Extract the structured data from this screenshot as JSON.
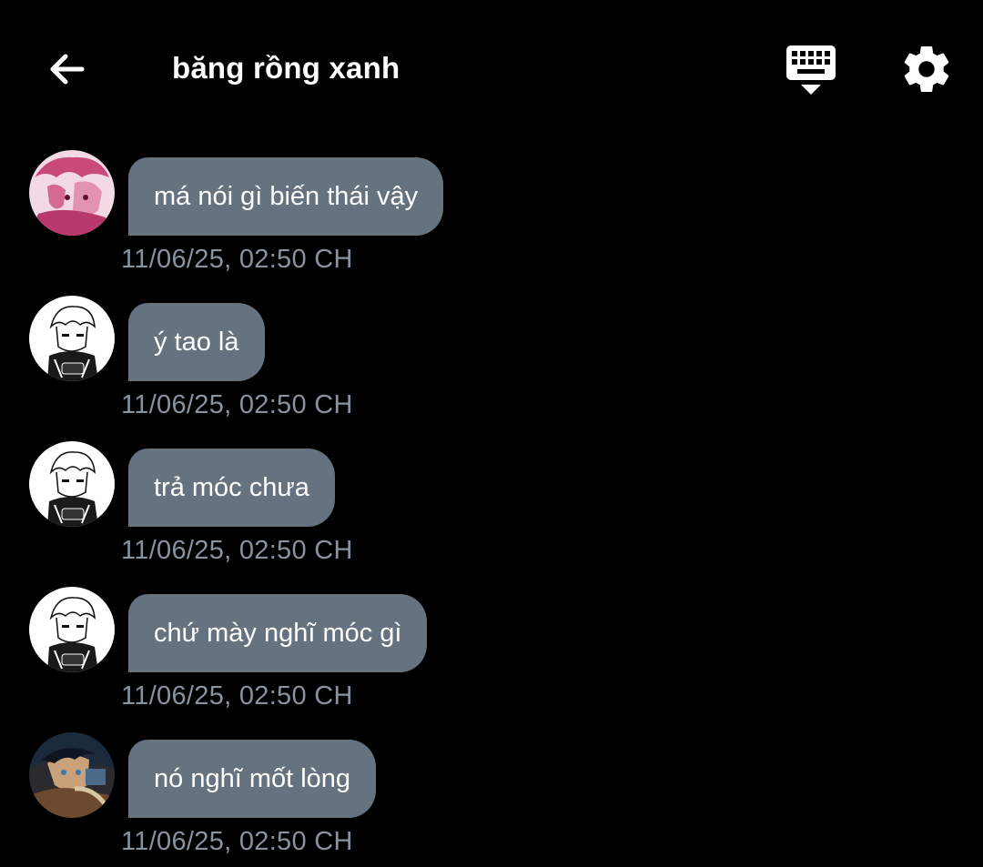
{
  "header": {
    "title": "băng rồng xanh",
    "back_icon": "arrow-left-icon",
    "keyboard_icon": "keyboard-hide-icon",
    "settings_icon": "gear-icon"
  },
  "colors": {
    "background": "#000000",
    "bubble": "#66727f",
    "timestamp": "#8893a0",
    "text": "#ffffff"
  },
  "messages": [
    {
      "avatar": "pink-manga-avatar",
      "text": "má nói gì biến thái vậy",
      "time": "11/06/25, 02:50 CH"
    },
    {
      "avatar": "white-hair-manga-avatar",
      "text": "ý tao là",
      "time": "11/06/25, 02:50 CH"
    },
    {
      "avatar": "white-hair-manga-avatar",
      "text": "trả móc chưa",
      "time": "11/06/25, 02:50 CH"
    },
    {
      "avatar": "white-hair-manga-avatar",
      "text": "chứ mày nghĩ móc gì",
      "time": "11/06/25, 02:50 CH"
    },
    {
      "avatar": "dark-hair-anime-avatar",
      "text": "nó nghĩ mốt lòng",
      "time": "11/06/25, 02:50 CH"
    }
  ]
}
